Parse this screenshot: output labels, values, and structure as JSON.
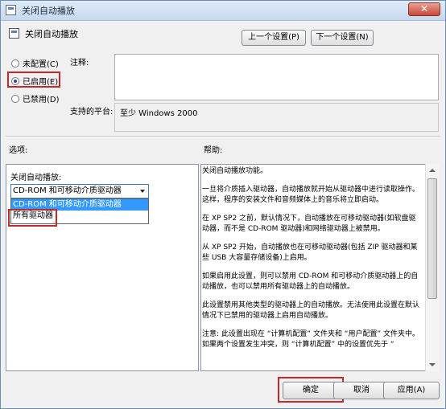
{
  "window": {
    "title": "关闭自动播放",
    "close_glyph": "✕"
  },
  "header": {
    "setting_name": "关闭自动播放"
  },
  "nav": {
    "prev_label": "上一个设置(P)",
    "next_label": "下一个设置(N)"
  },
  "state": {
    "options": [
      {
        "label": "未配置(C)",
        "selected": false
      },
      {
        "label": "已启用(E)",
        "selected": true
      },
      {
        "label": "已禁用(D)",
        "selected": false
      }
    ]
  },
  "comment": {
    "label": "注释:",
    "value": ""
  },
  "platform": {
    "label": "支持的平台:",
    "value": "至少 Windows 2000"
  },
  "options_section": {
    "title": "选项:",
    "field_label": "关闭自动播放:",
    "combo_value": "CD-ROM 和可移动介质驱动器",
    "dropdown_items": [
      "CD-ROM 和可移动介质驱动器",
      "所有驱动器"
    ]
  },
  "help_section": {
    "title": "帮助:",
    "paragraphs": [
      "关闭自动播放功能。",
      "一旦将介质插入驱动器，自动播放就开始从驱动器中进行读取操作。这样，程序的安装文件和音频媒体上的音乐将立即启动。",
      "在 XP SP2 之前，默认情况下，自动播放在可移动驱动器(如软盘驱动器，而不是 CD-ROM 驱动器)和网络驱动器上被禁用。",
      "从 XP SP2 开始，自动播放也在可移动驱动器(包括 ZIP 驱动器和某些 USB 大容量存储设备)上启用。",
      "如果启用此设置，则可以禁用 CD-ROM 和可移动介质驱动器上的自动播放，也可以禁用所有驱动器上的自动播放。",
      "此设置禁用其他类型的驱动器上的自动播放。无法使用此设置在默认情况下已禁用的驱动器上启用自动播放。",
      "注意: 此设置出现在 “计算机配置” 文件夹和 “用户配置” 文件夹中。如果两个设置发生冲突，则 “计算机配置” 中的设置优先于 “"
    ]
  },
  "buttons": {
    "ok": "确定",
    "cancel": "取消",
    "apply": "应用(A)"
  },
  "colors": {
    "highlight_red": "#c22a2a",
    "selection_blue": "#3399ff"
  }
}
